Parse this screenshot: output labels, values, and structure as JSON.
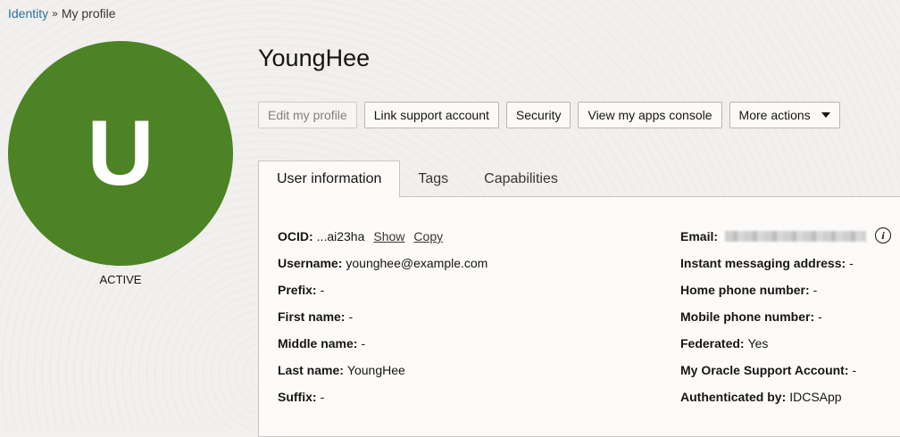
{
  "breadcrumb": {
    "root": "Identity",
    "separator": "»",
    "current": "My profile"
  },
  "avatar": {
    "letter": "U",
    "color": "#4c8325",
    "status": "ACTIVE"
  },
  "title": "YoungHee",
  "actions": {
    "edit": "Edit my profile",
    "link_support": "Link support account",
    "security": "Security",
    "apps_console": "View my apps console",
    "more": "More actions"
  },
  "tabs": [
    "User information",
    "Tags",
    "Capabilities"
  ],
  "info_left": {
    "ocid_label": "OCID:",
    "ocid_value": "...ai23ha",
    "show": "Show",
    "copy": "Copy",
    "username_label": "Username:",
    "username_value": "younghee@example.com",
    "prefix_label": "Prefix:",
    "prefix_value": "-",
    "first_label": "First name:",
    "first_value": "-",
    "middle_label": "Middle name:",
    "middle_value": "-",
    "last_label": "Last name:",
    "last_value": "YoungHee",
    "suffix_label": "Suffix:",
    "suffix_value": "-"
  },
  "info_right": {
    "email_label": "Email:",
    "im_label": "Instant messaging address:",
    "im_value": "-",
    "home_label": "Home phone number:",
    "home_value": "-",
    "mobile_label": "Mobile phone number:",
    "mobile_value": "-",
    "federated_label": "Federated:",
    "federated_value": "Yes",
    "mos_label": "My Oracle Support Account:",
    "mos_value": "-",
    "auth_label": "Authenticated by:",
    "auth_value": "IDCSApp"
  }
}
